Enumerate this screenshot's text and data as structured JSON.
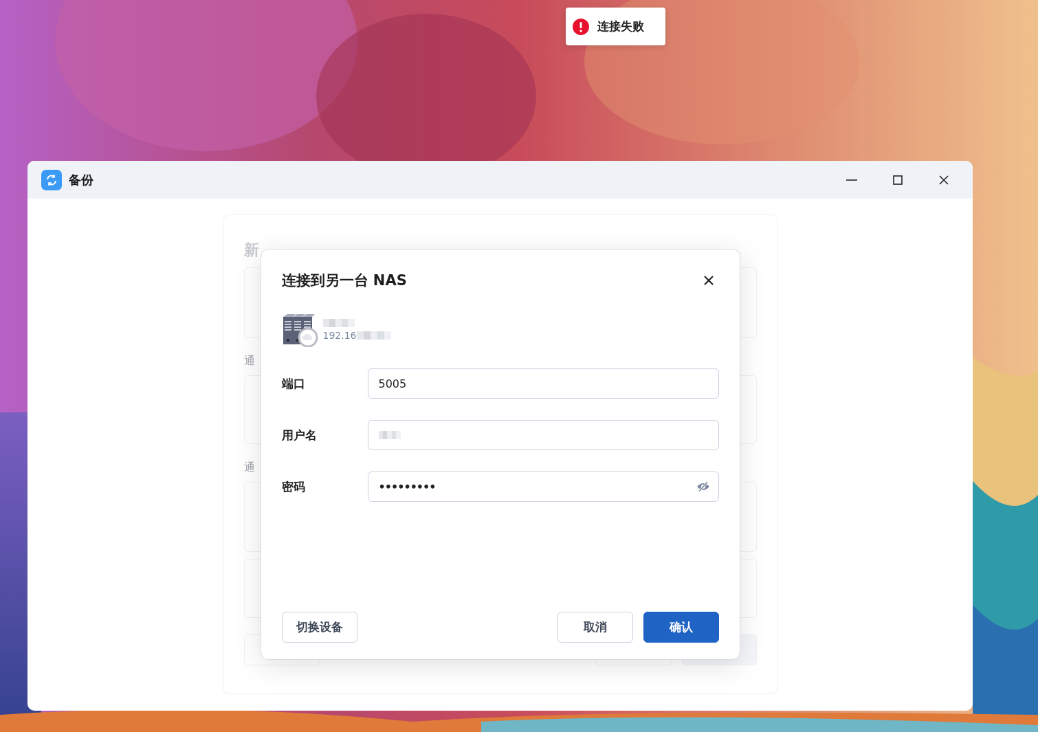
{
  "toast": {
    "message": "连接失败"
  },
  "window": {
    "title": "备份"
  },
  "background_panel": {
    "title": "新",
    "labels": [
      "通",
      "通"
    ]
  },
  "dialog": {
    "title": "连接到另一台 NAS",
    "device": {
      "address": "192.16"
    },
    "fields": [
      {
        "label": "端口",
        "kind": "text",
        "value": "5005"
      },
      {
        "label": "用户名",
        "kind": "redacted"
      },
      {
        "label": "密码",
        "kind": "password",
        "value": "•••••••••"
      }
    ],
    "buttons": [
      {
        "label": "切换设备",
        "kind": "secondary"
      },
      {
        "label": "取消",
        "kind": "secondary"
      },
      {
        "label": "确认",
        "kind": "primary"
      }
    ]
  }
}
